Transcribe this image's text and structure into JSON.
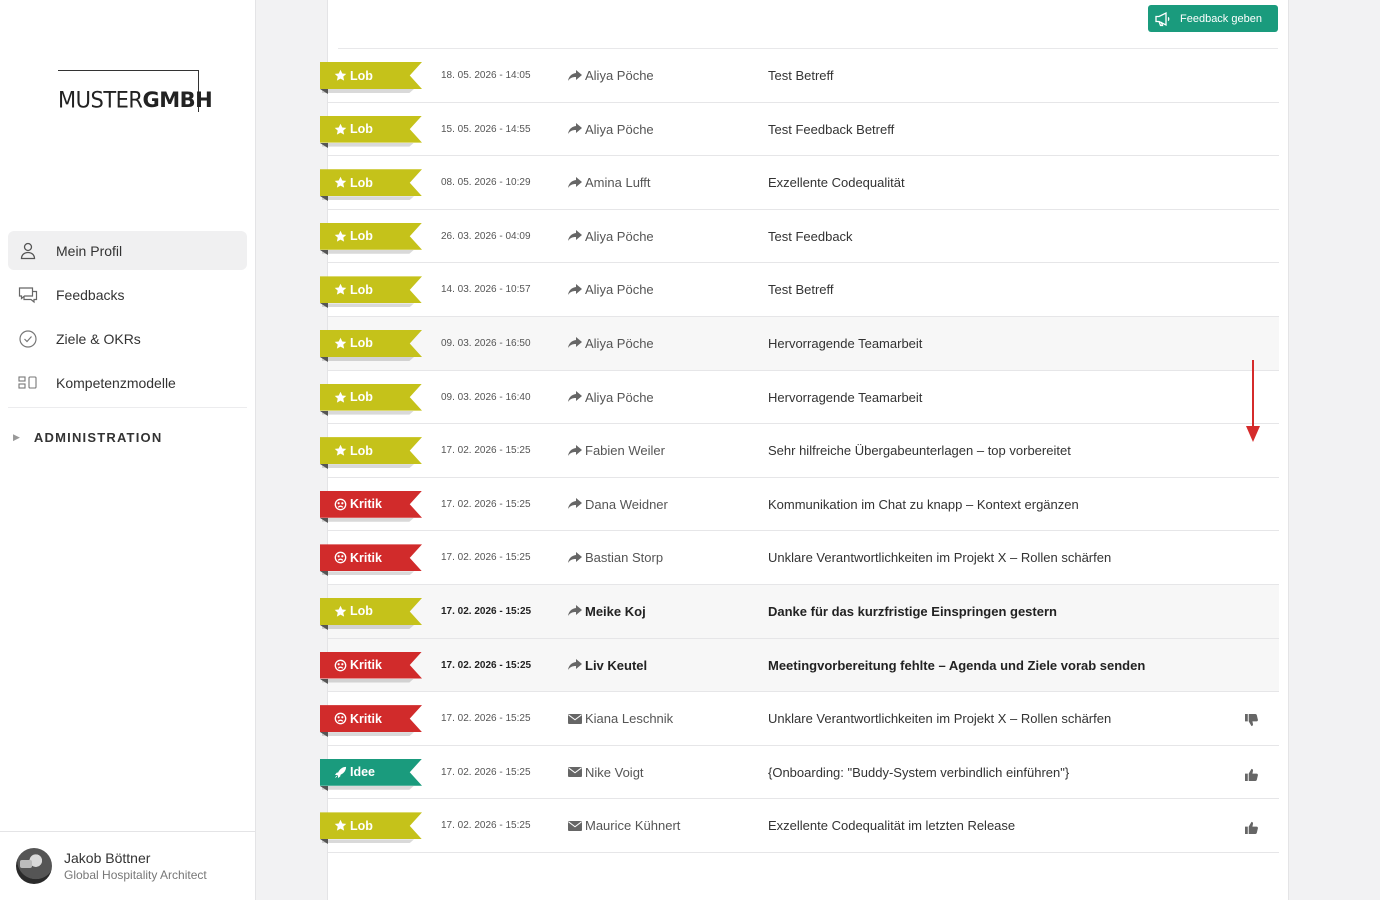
{
  "logo": {
    "light": "MUSTER",
    "bold": "GMBH"
  },
  "sidebar": {
    "items": [
      {
        "label": "Mein Profil",
        "icon": "user-icon",
        "active": true
      },
      {
        "label": "Feedbacks",
        "icon": "chat-icon",
        "active": false
      },
      {
        "label": "Ziele & OKRs",
        "icon": "check-circle-icon",
        "active": false
      },
      {
        "label": "Kompetenzmodelle",
        "icon": "blocks-icon",
        "active": false
      }
    ],
    "admin_label": "ADMINISTRATION"
  },
  "profile": {
    "name": "Jakob Böttner",
    "role": "Global Hospitality Architect"
  },
  "toolbar": {
    "feedback_button": "Feedback geben"
  },
  "colors": {
    "lob": "#c5c21a",
    "kritik": "#d12b2b",
    "idee": "#1a9b7d",
    "accent": "#1a9b7d"
  },
  "feedbacks": [
    {
      "type": "lob",
      "label": "Lob",
      "date": "18. 05. 2026 - 14:05",
      "sender_icon": "share-icon",
      "sender": "Aliya Pöche",
      "subject": "Test Betreff",
      "shaded": false,
      "bold": false,
      "thumb": ""
    },
    {
      "type": "lob",
      "label": "Lob",
      "date": "15. 05. 2026 - 14:55",
      "sender_icon": "share-icon",
      "sender": "Aliya Pöche",
      "subject": "Test Feedback Betreff",
      "shaded": false,
      "bold": false,
      "thumb": ""
    },
    {
      "type": "lob",
      "label": "Lob",
      "date": "08. 05. 2026 - 10:29",
      "sender_icon": "share-icon",
      "sender": "Amina Lufft",
      "subject": "Exzellente Codequalität",
      "shaded": false,
      "bold": false,
      "thumb": ""
    },
    {
      "type": "lob",
      "label": "Lob",
      "date": "26. 03. 2026 - 04:09",
      "sender_icon": "share-icon",
      "sender": "Aliya Pöche",
      "subject": "Test Feedback",
      "shaded": false,
      "bold": false,
      "thumb": ""
    },
    {
      "type": "lob",
      "label": "Lob",
      "date": "14. 03. 2026 - 10:57",
      "sender_icon": "share-icon",
      "sender": "Aliya Pöche",
      "subject": "Test Betreff",
      "shaded": false,
      "bold": false,
      "thumb": ""
    },
    {
      "type": "lob",
      "label": "Lob",
      "date": "09. 03. 2026 - 16:50",
      "sender_icon": "share-icon",
      "sender": "Aliya Pöche",
      "subject": "Hervorragende Teamarbeit",
      "shaded": true,
      "bold": false,
      "thumb": ""
    },
    {
      "type": "lob",
      "label": "Lob",
      "date": "09. 03. 2026 - 16:40",
      "sender_icon": "share-icon",
      "sender": "Aliya Pöche",
      "subject": "Hervorragende Teamarbeit",
      "shaded": false,
      "bold": false,
      "thumb": ""
    },
    {
      "type": "lob",
      "label": "Lob",
      "date": "17. 02. 2026 - 15:25",
      "sender_icon": "share-icon",
      "sender": "Fabien Weiler",
      "subject": "Sehr hilfreiche Übergabeunterlagen – top vorbereitet",
      "shaded": false,
      "bold": false,
      "thumb": ""
    },
    {
      "type": "kritik",
      "label": "Kritik",
      "date": "17. 02. 2026 - 15:25",
      "sender_icon": "share-icon",
      "sender": "Dana Weidner",
      "subject": "Kommunikation im Chat zu knapp – Kontext ergänzen",
      "shaded": false,
      "bold": false,
      "thumb": ""
    },
    {
      "type": "kritik",
      "label": "Kritik",
      "date": "17. 02. 2026 - 15:25",
      "sender_icon": "share-icon",
      "sender": "Bastian Storp",
      "subject": "Unklare Verantwortlichkeiten im Projekt X – Rollen schärfen",
      "shaded": false,
      "bold": false,
      "thumb": ""
    },
    {
      "type": "lob",
      "label": "Lob",
      "date": "17. 02. 2026 - 15:25",
      "sender_icon": "share-icon",
      "sender": "Meike Koj",
      "subject": "Danke für das kurzfristige Einspringen gestern",
      "shaded": true,
      "bold": true,
      "thumb": ""
    },
    {
      "type": "kritik",
      "label": "Kritik",
      "date": "17. 02. 2026 - 15:25",
      "sender_icon": "share-icon",
      "sender": "Liv Keutel",
      "subject": "Meetingvorbereitung fehlte – Agenda und Ziele vorab senden",
      "shaded": true,
      "bold": true,
      "thumb": ""
    },
    {
      "type": "kritik",
      "label": "Kritik",
      "date": "17. 02. 2026 - 15:25",
      "sender_icon": "envelope-icon",
      "sender": "Kiana Leschnik",
      "subject": "Unklare Verantwortlichkeiten im Projekt X – Rollen schärfen",
      "shaded": false,
      "bold": false,
      "thumb": "thumbs-down-icon"
    },
    {
      "type": "idee",
      "label": "Idee",
      "date": "17. 02. 2026 - 15:25",
      "sender_icon": "envelope-icon",
      "sender": "Nike Voigt",
      "subject": "{Onboarding: \"Buddy-System verbindlich einführen\"}",
      "shaded": false,
      "bold": false,
      "thumb": "thumbs-up-icon"
    },
    {
      "type": "lob",
      "label": "Lob",
      "date": "17. 02. 2026 - 15:25",
      "sender_icon": "envelope-icon",
      "sender": "Maurice Kühnert",
      "subject": "Exzellente Codequalität im letzten Release",
      "shaded": false,
      "bold": false,
      "thumb": "thumbs-up-icon"
    }
  ]
}
